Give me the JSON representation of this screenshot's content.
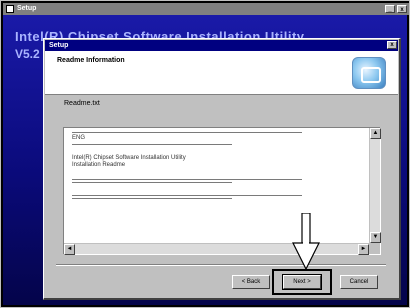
{
  "outer_window": {
    "title": "Setup",
    "heading": "Intel(R) Chipset Software Installation Utility",
    "version": "V5.2",
    "buttons": {
      "minimize": "_",
      "close": "x"
    }
  },
  "dialog": {
    "title": "Setup",
    "close_label": "x",
    "header_title": "Readme Information",
    "label": "Readme.txt",
    "readme": {
      "lines_top": [
        "ENG"
      ],
      "lines_body": [
        "Intel(R) Chipset Software Installation Utility",
        "Installation Readme"
      ]
    },
    "scroll": {
      "up": "▲",
      "down": "▼",
      "left": "◄",
      "right": "►"
    },
    "buttons": {
      "back": "< Back",
      "next": "Next >",
      "cancel": "Cancel"
    }
  },
  "colors": {
    "dialog_title_bg": "#000080",
    "outer_bg": "#0a0a7a",
    "face": "#c0c0c0"
  },
  "icons": [
    "setup-logo-icon",
    "arrow-pointer-icon"
  ]
}
